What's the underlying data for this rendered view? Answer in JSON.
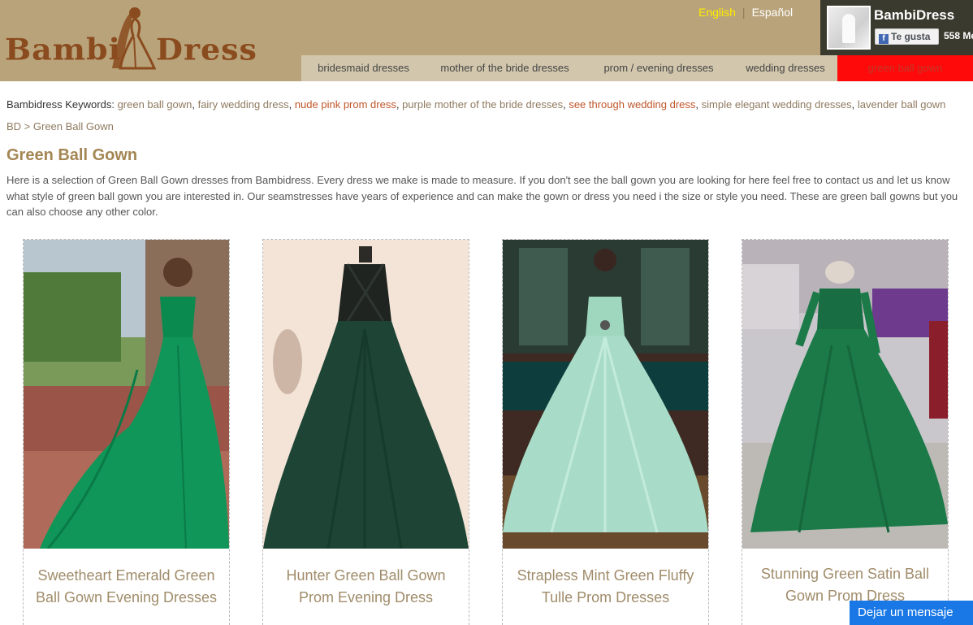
{
  "header": {
    "logo_left": "Bambi",
    "logo_right": "Dress",
    "language": {
      "english": "English",
      "separator": "|",
      "spanish": "Español"
    },
    "facebook": {
      "page_name": "BambiDress",
      "like_label": "Te gusta",
      "like_count": "558 Me"
    },
    "nav": [
      {
        "label": "bridesmaid dresses"
      },
      {
        "label": "mother of the bride dresses"
      },
      {
        "label": "prom / evening dresses"
      },
      {
        "label": "wedding dresses"
      },
      {
        "label": "green ball gown"
      }
    ]
  },
  "keywords": {
    "label": "Bambidress Keywords: ",
    "items": [
      {
        "text": "green ball gown"
      },
      {
        "text": "fairy wedding dress"
      },
      {
        "text": "nude pink prom dress"
      },
      {
        "text": "purple mother of the bride dresses"
      },
      {
        "text": "see through wedding dress"
      },
      {
        "text": "simple elegant wedding dresses"
      },
      {
        "text": "lavender ball gown"
      }
    ],
    "separator": ", "
  },
  "breadcrumb": {
    "root": "BD",
    "separator": " > ",
    "current": "Green Ball Gown"
  },
  "page": {
    "title": "Green Ball Gown",
    "intro": "Here is a selection of Green Ball Gown dresses from Bambidress. Every dress we make is made to measure. If you don't see the ball gown you are looking for here feel free to contact us and let us know what style of green ball gown you are interested in. Our seamstresses have years of experience and can make the gown or dress you need i the size or style you need. These are green ball gowns but you can also choose any other color."
  },
  "products": [
    {
      "title": "Sweetheart Emerald Green Ball Gown Evening Dresses"
    },
    {
      "title": "Hunter Green Ball Gown Prom Evening Dress"
    },
    {
      "title": "Strapless Mint Green Fluffy Tulle Prom Dresses"
    },
    {
      "title": "Stunning Green Satin Ball Gown Prom Dress"
    }
  ],
  "chat": {
    "label": "Dejar un mensaje"
  },
  "colors": {
    "header_bg": "#b9a37a",
    "nav_bg": "#d2c7ad",
    "nav_active": "#ff0a0a",
    "title_gold": "#a48654",
    "chat_blue": "#1978e5"
  }
}
